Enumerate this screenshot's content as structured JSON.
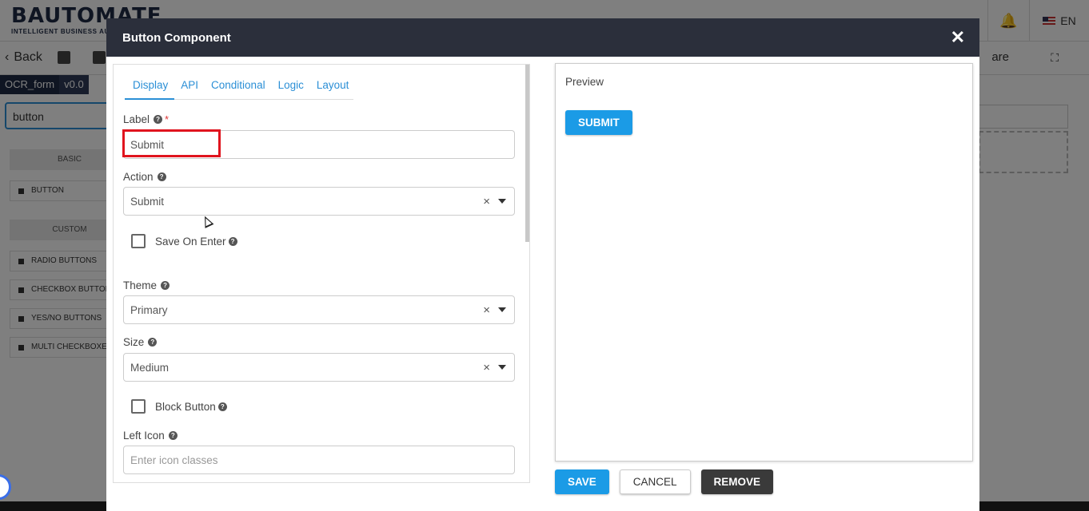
{
  "app": {
    "logo_text": "BAUTOMATE",
    "logo_sub": "INTELLIGENT BUSINESS AU",
    "lang": "EN",
    "back_label": "Back",
    "toolbar_right_text": "are",
    "form_name": "OCR_form",
    "form_version": "v0.0",
    "search_value": "button",
    "sidebar": {
      "basic_header": "BASIC",
      "basic_items": [
        "BUTTON"
      ],
      "custom_header": "CUSTOM",
      "custom_items": [
        "RADIO BUTTONS",
        "CHECKBOX BUTTON",
        "YES/NO BUTTONS",
        "MULTI CHECKBOXES"
      ]
    }
  },
  "modal": {
    "title": "Button Component",
    "close_glyph": "✕",
    "tabs": [
      "Display",
      "API",
      "Conditional",
      "Logic",
      "Layout"
    ],
    "active_tab": "Display",
    "fields": {
      "label": {
        "label": "Label",
        "required_mark": "*",
        "value": "Submit"
      },
      "action": {
        "label": "Action",
        "value": "Submit"
      },
      "save_on_enter": {
        "label": "Save On Enter",
        "checked": false
      },
      "theme": {
        "label": "Theme",
        "value": "Primary"
      },
      "size": {
        "label": "Size",
        "value": "Medium"
      },
      "block_button": {
        "label": "Block Button",
        "checked": false
      },
      "left_icon": {
        "label": "Left Icon",
        "placeholder": "Enter icon classes"
      }
    },
    "clear_glyph": "×",
    "help_glyph": "?",
    "preview": {
      "label": "Preview",
      "button_label": "SUBMIT"
    },
    "footer": {
      "save": "SAVE",
      "cancel": "CANCEL",
      "remove": "REMOVE"
    }
  },
  "colors": {
    "primary": "#1b9be6",
    "header_bg": "#2b2f3b",
    "highlight": "#e0141e",
    "remove_bg": "#3a3a3a"
  },
  "icons": [
    "bell-icon",
    "flag-us-icon",
    "back-chevron-icon",
    "save-icon",
    "close-icon",
    "help-icon",
    "clear-icon",
    "caret-down-icon",
    "expand-icon"
  ]
}
